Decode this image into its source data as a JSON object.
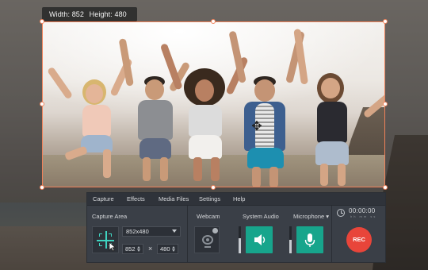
{
  "dimensions_label": {
    "width": "Width: 852",
    "height": "Height: 480"
  },
  "menu": [
    "Capture",
    "Effects",
    "Media Files",
    "Settings",
    "Help"
  ],
  "capture_area": {
    "label": "Capture Area",
    "preset": "852x480",
    "width": "852",
    "height": "480",
    "times": "×"
  },
  "webcam": {
    "label": "Webcam"
  },
  "system_audio": {
    "label": "System Audio",
    "level": 0.55
  },
  "microphone": {
    "label": "Microphone ▾",
    "level": 0.5
  },
  "timer": {
    "value": "00:00:00",
    "units": "hh mm ss"
  },
  "rec_button": {
    "label": "REC"
  },
  "colors": {
    "accent": "#f0825a",
    "teal": "#17a58c",
    "rec": "#e8453a",
    "panel": "#3a3f47"
  },
  "icons": {
    "crosshair": "crosshair-icon",
    "arrow": "cursor-arrow-icon",
    "webcam": "webcam-icon",
    "speaker": "speaker-icon",
    "microphone": "microphone-icon",
    "timer": "alarm-clock-icon",
    "move": "move-cursor-icon"
  }
}
